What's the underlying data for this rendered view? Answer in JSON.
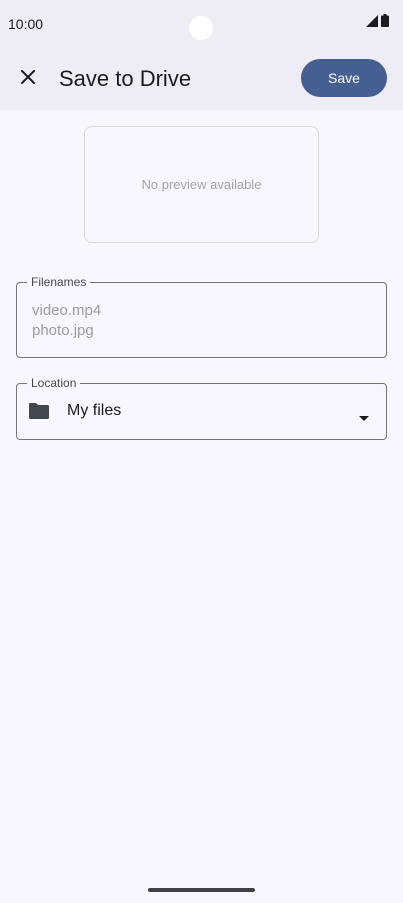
{
  "status_bar": {
    "time": "10:00",
    "signal_icon": "signal-icon",
    "battery_icon": "battery-icon"
  },
  "app_bar": {
    "close_icon": "close-icon",
    "title": "Save to Drive",
    "save_label": "Save"
  },
  "preview": {
    "text": "No preview available"
  },
  "filenames": {
    "label": "Filenames",
    "items": [
      "video.mp4",
      "photo.jpg"
    ]
  },
  "location": {
    "label": "Location",
    "value": "My files",
    "folder_icon": "folder-icon",
    "dropdown_icon": "dropdown-arrow-icon"
  },
  "colors": {
    "accent": "#465f92",
    "app_bar_bg": "#eeedf5",
    "page_bg": "#f8f7fd"
  }
}
